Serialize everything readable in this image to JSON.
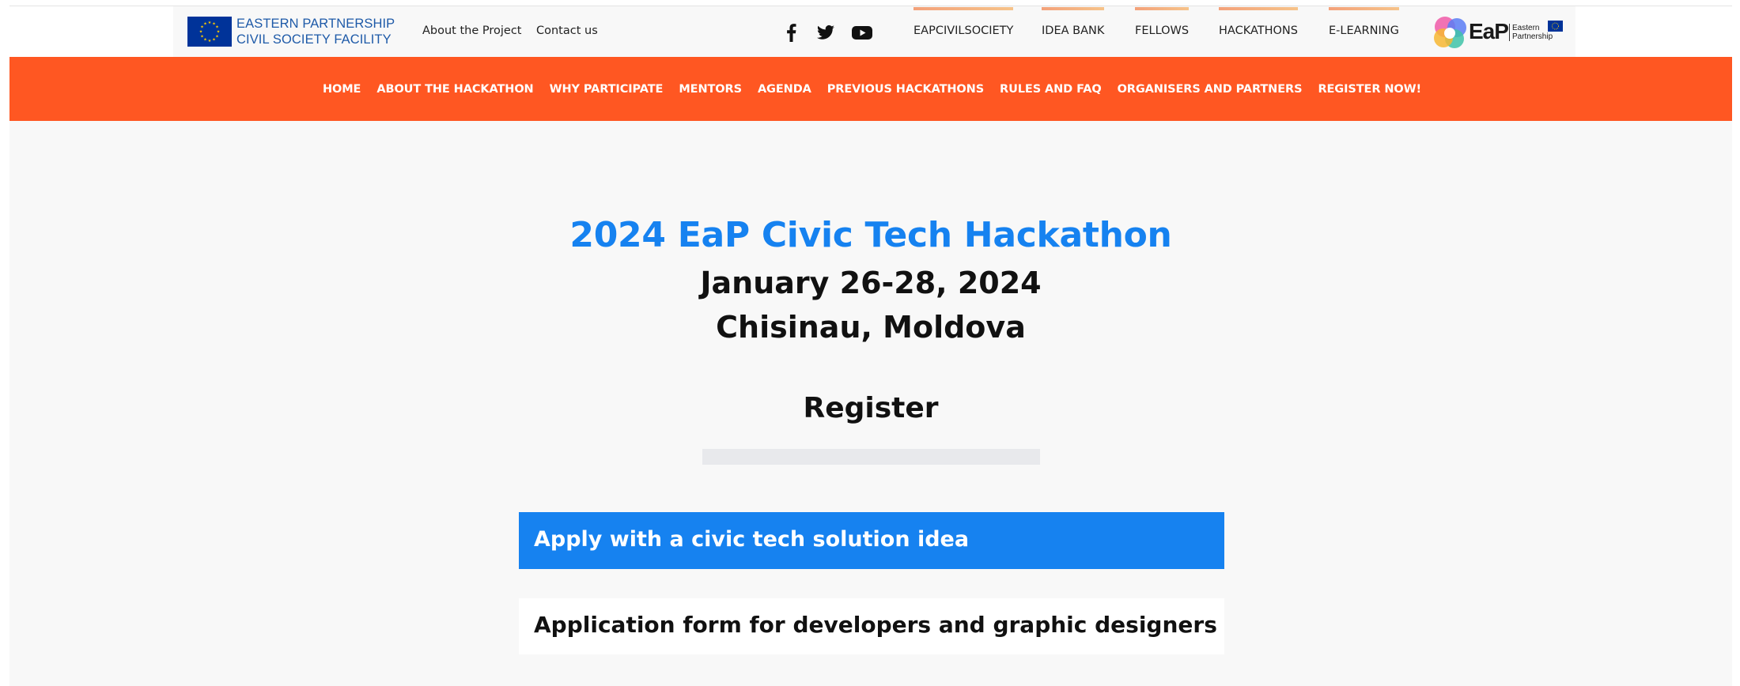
{
  "header": {
    "brand_line1": "EASTERN PARTNERSHIP",
    "brand_line2": "CIVIL SOCIETY FACILITY",
    "links": [
      "About the Project",
      "Contact us"
    ],
    "social_icons": [
      "facebook-icon",
      "twitter-icon",
      "youtube-icon"
    ],
    "site_nav": [
      "EAPCIVILSOCIETY",
      "IDEA BANK",
      "FELLOWS",
      "HACKATHONS",
      "E-LEARNING"
    ],
    "eap_logo": {
      "word": "EaP",
      "sub_line1": "Eastern",
      "sub_line2": "Partnership"
    }
  },
  "main_nav": {
    "items": [
      "HOME",
      "ABOUT THE HACKATHON",
      "WHY PARTICIPATE",
      "MENTORS",
      "AGENDA",
      "PREVIOUS HACKATHONS",
      "RULES AND FAQ",
      "ORGANISERS AND PARTNERS",
      "REGISTER NOW!"
    ]
  },
  "hero": {
    "title": "2024 EaP Civic Tech Hackathon",
    "date": "January 26-28, 2024",
    "location": "Chisinau, Moldova"
  },
  "register": {
    "heading": "Register",
    "apply_label": "Apply with a civic tech solution idea",
    "form_label": "Application form for developers and graphic designers"
  },
  "colors": {
    "accent_orange": "#ff5722",
    "accent_blue": "#1682f0",
    "eu_blue": "#003399"
  }
}
